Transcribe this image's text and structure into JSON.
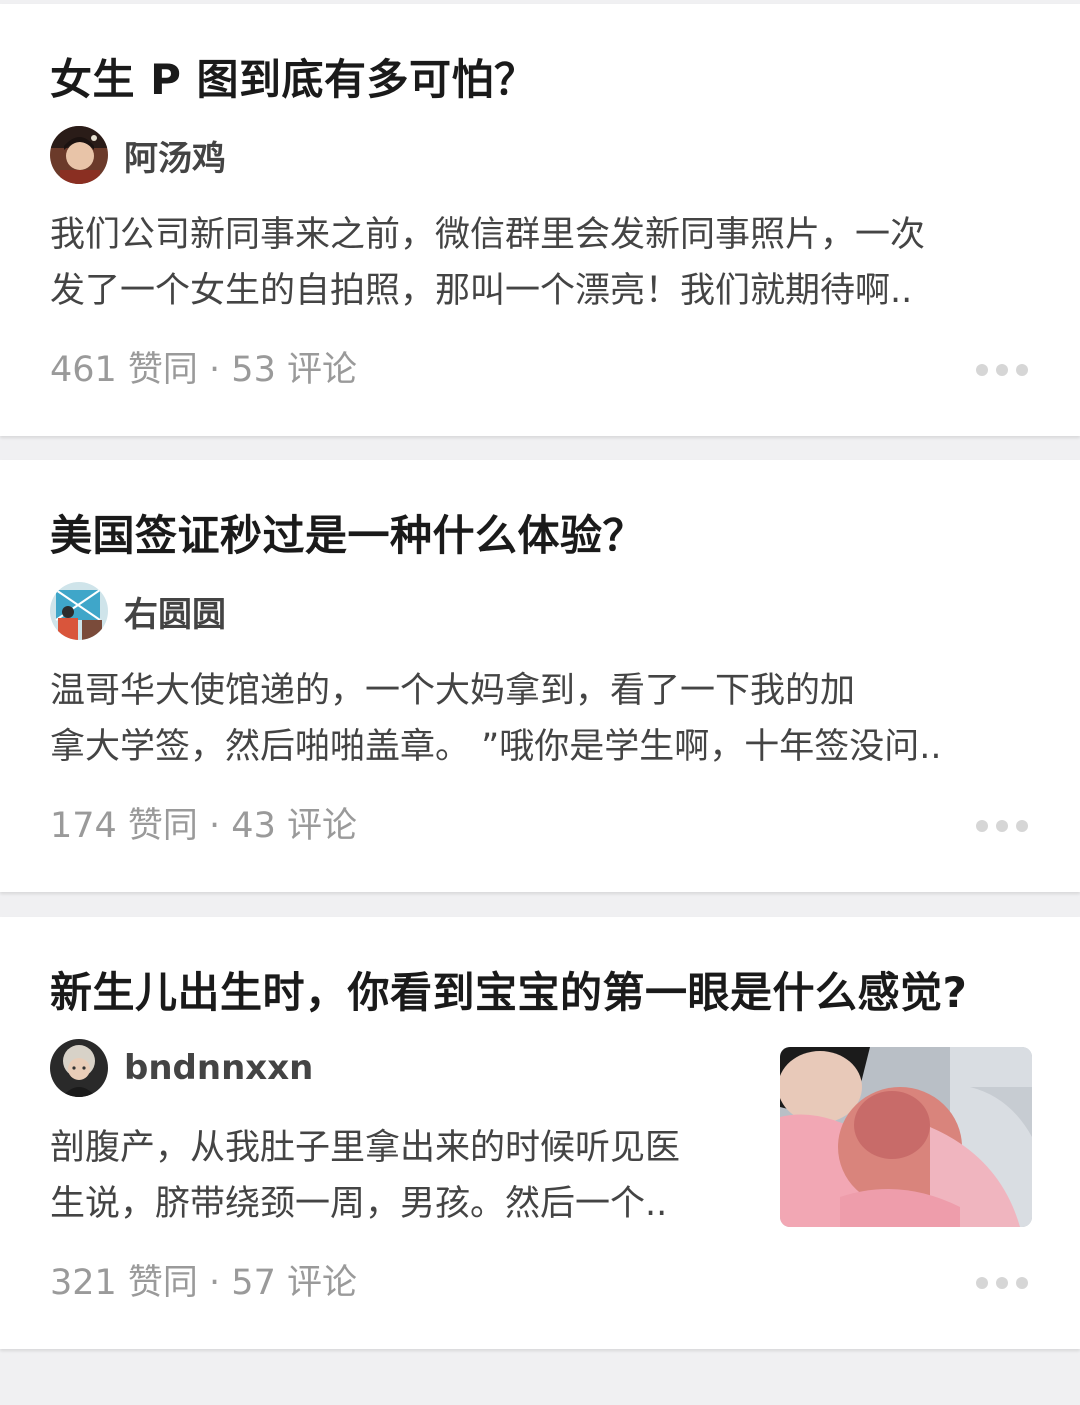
{
  "feed": {
    "items": [
      {
        "title": "女生 P 图到底有多可怕？",
        "author": "阿汤鸡",
        "excerpt_lines": [
          "我们公司新同事来之前，微信群里会发新同事照片，一次",
          "发了一个女生的自拍照，那叫一个漂亮！我们就期待啊.."
        ],
        "stats": "461 赞同 · 53 评论"
      },
      {
        "title": "美国签证秒过是一种什么体验？",
        "author": "右圆圆",
        "excerpt_lines": [
          "温哥华大使馆递的，一个大妈拿到，看了一下我的加",
          "拿大学签，然后啪啪盖章。 ”哦你是学生啊，十年签没问.."
        ],
        "stats": "174 赞同 · 43 评论"
      },
      {
        "title": "新生儿出生时，你看到宝宝的第一眼是什么感觉?",
        "author": "bndnnxxn",
        "excerpt_lines": [
          "剖腹产，从我肚子里拿出来的时候听见医",
          "生说，脐带绕颈一周，男孩。然后一个.."
        ],
        "stats": "321 赞同 · 57 评论"
      }
    ]
  },
  "icons": {
    "more": "more-horizontal-icon"
  },
  "colors": {
    "title": "#1a1a1a",
    "author": "#444444",
    "excerpt": "#444444",
    "stats": "#9a9a9a",
    "divider": "#f0f0f2",
    "more_dots": "#d6d6d6"
  }
}
